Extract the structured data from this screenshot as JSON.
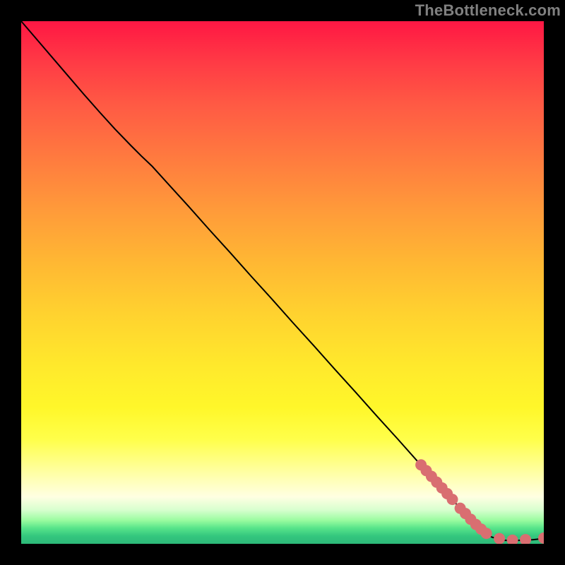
{
  "watermark": "TheBottleneck.com",
  "chart_data": {
    "type": "line",
    "title": "",
    "xlabel": "",
    "ylabel": "",
    "xlim": [
      0,
      100
    ],
    "ylim": [
      0,
      100
    ],
    "grid": false,
    "legend": false,
    "series": [
      {
        "name": "curve",
        "style": "line",
        "color": "#000000",
        "width": 2,
        "x": [
          0.0,
          3.0,
          6.0,
          9.0,
          12.0,
          15.0,
          18.0,
          21.0,
          23.0,
          25.0,
          28.0,
          32.0,
          36.0,
          40.0,
          44.0,
          48.0,
          52.0,
          56.0,
          60.0,
          64.0,
          68.0,
          72.0,
          76.0,
          80.0,
          83.0,
          86.0,
          88.5,
          90.0,
          92.0,
          94.0,
          96.0,
          98.0,
          100.0
        ],
        "y": [
          100.0,
          96.5,
          93.0,
          89.5,
          86.0,
          82.6,
          79.3,
          76.2,
          74.2,
          72.3,
          69.0,
          64.6,
          60.1,
          55.7,
          51.2,
          46.8,
          42.3,
          37.9,
          33.4,
          29.0,
          24.5,
          20.1,
          15.6,
          11.2,
          7.9,
          4.6,
          2.4,
          1.3,
          0.7,
          0.6,
          0.7,
          0.8,
          1.0
        ]
      },
      {
        "name": "markers",
        "style": "scatter",
        "color": "#d96e71",
        "radius": 8,
        "x": [
          76.5,
          77.5,
          78.5,
          79.5,
          80.5,
          81.5,
          82.5,
          84.0,
          85.0,
          86.0,
          87.0,
          88.0,
          89.0,
          91.5,
          94.0,
          96.5,
          100.0
        ],
        "y": [
          15.1,
          14.0,
          12.9,
          11.8,
          10.7,
          9.6,
          8.5,
          6.8,
          5.8,
          4.7,
          3.7,
          2.8,
          2.0,
          1.0,
          0.7,
          0.8,
          1.1
        ]
      }
    ]
  }
}
